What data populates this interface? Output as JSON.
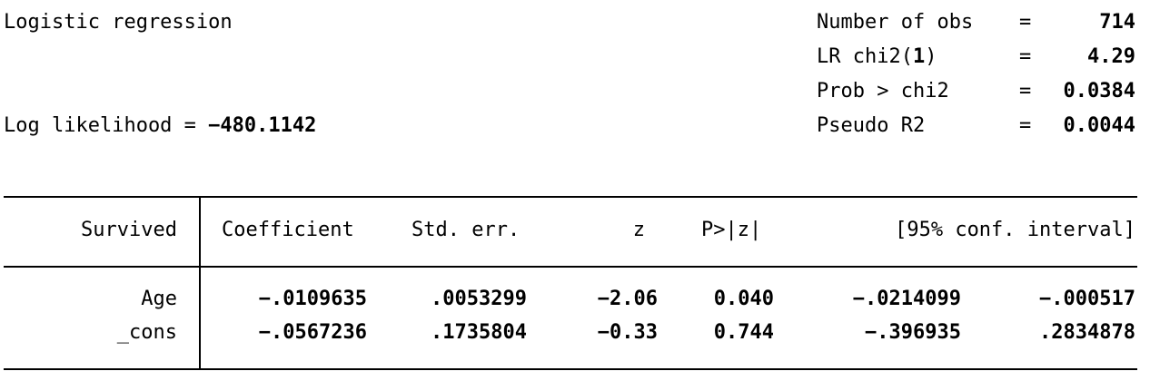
{
  "header": {
    "title": "Logistic regression",
    "loglik_label": "Log likelihood = ",
    "loglik_value": "−480.1142",
    "stats": [
      {
        "label": "Number of obs",
        "eq": "=",
        "value": "714"
      },
      {
        "label": "LR chi2(",
        "label_bold": "1",
        "label_tail": ")",
        "eq": "=",
        "value": "4.29"
      },
      {
        "label": "Prob > chi2",
        "eq": "=",
        "value": "0.0384"
      },
      {
        "label": "Pseudo R2",
        "eq": "=",
        "value": "0.0044"
      }
    ]
  },
  "table": {
    "depvar": "Survived",
    "columns": [
      "Coefficient",
      "Std. err.",
      "z",
      "P>|z|",
      "[95% conf. interval]"
    ],
    "rows": [
      {
        "name": "Age",
        "coef": "−.0109635",
        "se": ".0053299",
        "z": "−2.06",
        "p": "0.040",
        "ci_low": "−.0214099",
        "ci_high": "−.000517"
      },
      {
        "name": "_cons",
        "coef": "−.0567236",
        "se": ".1735804",
        "z": "−0.33",
        "p": "0.744",
        "ci_low": "−.396935",
        "ci_high": ".2834878"
      }
    ]
  }
}
